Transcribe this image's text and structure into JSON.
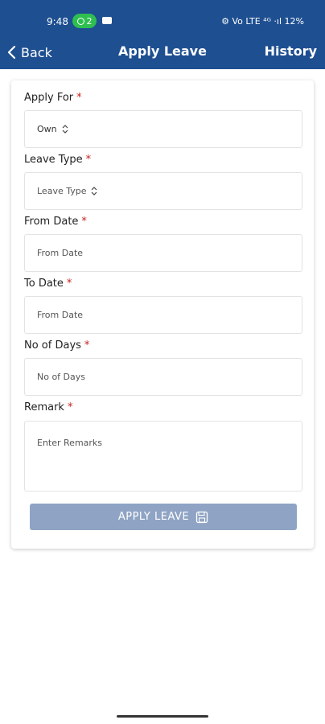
{
  "status": {
    "time": "9:48",
    "badge_count": "2",
    "right_text": "⚙ Vo LTE ⁴ᴳ ·ıl 12%"
  },
  "appbar": {
    "back_label": "Back",
    "title": "Apply Leave",
    "history_label": "History"
  },
  "form": {
    "apply_for": {
      "label": "Apply For",
      "value": "Own"
    },
    "leave_type": {
      "label": "Leave Type",
      "placeholder": "Leave Type"
    },
    "from_date": {
      "label": "From Date",
      "placeholder": "From Date"
    },
    "to_date": {
      "label": "To Date",
      "placeholder": "From Date"
    },
    "no_of_days": {
      "label": "No of Days",
      "placeholder": "No of Days"
    },
    "remark": {
      "label": "Remark",
      "placeholder": "Enter Remarks"
    },
    "required_marker": "*",
    "submit_label": "APPLY LEAVE"
  },
  "colors": {
    "header": "#1e4f91",
    "button_disabled": "#8fa4c4",
    "required": "#c81e1e"
  }
}
